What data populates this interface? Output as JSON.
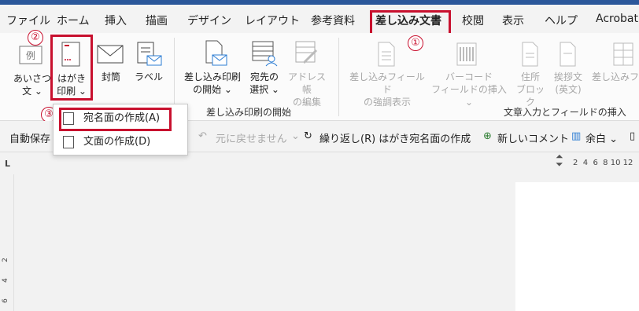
{
  "tabs": [
    "ファイル",
    "ホーム",
    "挿入",
    "描画",
    "デザイン",
    "レイアウト",
    "参考資料",
    "差し込み文書",
    "校閲",
    "表示",
    "ヘルプ",
    "Acrobat"
  ],
  "active_tab": "差し込み文書",
  "annotations": [
    "①",
    "②",
    "③"
  ],
  "ribbon": {
    "greeting": "あいさつ\n文 ⌄",
    "hagaki": "はがき\n印刷 ⌄",
    "envelope": "封筒",
    "label": "ラベル",
    "start_merge": "差し込み印刷\nの開始 ⌄",
    "select_recipients": "宛先の\n選択 ⌄",
    "edit_addresses": "アドレス帳\nの編集",
    "highlight_fields": "差し込みフィールド\nの強調表示",
    "barcode": "バーコード\nフィールドの挿入 ⌄",
    "address_block": "住所\nブロック",
    "greeting_line": "挨拶文\n(英文)",
    "insert_field": "差し込みフ",
    "group_start": "差し込み印刷の開始",
    "group_write": "文章入力とフィールドの挿入"
  },
  "menu": {
    "item1": "宛名面の作成(A)",
    "item2": "文面の作成(D)"
  },
  "qat": {
    "autosave": "自動保存",
    "undo": "元に戻せません",
    "redo": "繰り返し(R) はがき宛名面の作成",
    "new_comment": "新しいコメント",
    "margins": "余白 ⌄"
  },
  "ruler": {
    "h_ticks": "2  4  6  8 10 12",
    "v_ticks": [
      "2",
      "4",
      "6"
    ],
    "corner": "L"
  }
}
